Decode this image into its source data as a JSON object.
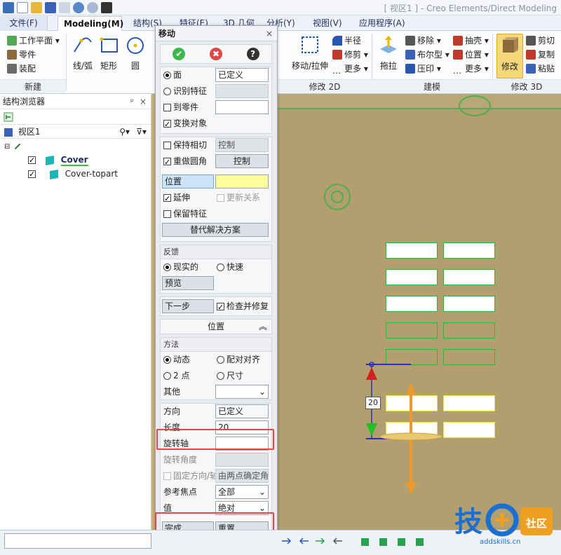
{
  "window": {
    "title": "[ 视区1 ] - Creo Elements/Direct Modeling"
  },
  "ribbon": {
    "tabs": [
      "文件(F)",
      "Modeling(M)",
      "结构(S)",
      "特征(E)",
      "3D 几何",
      "分析(Y)",
      "视图(V)",
      "应用程序(A)"
    ],
    "new_group": {
      "label": "新建",
      "items": [
        "工作平面",
        "零件",
        "装配"
      ]
    },
    "sketch_items": [
      "线/弧",
      "矩形",
      "圆"
    ],
    "modify2d_group": {
      "label": "修改 2D",
      "big": "移动/拉伸",
      "items": [
        "半径",
        "修剪",
        "更多"
      ]
    },
    "model_group": {
      "label": "建模",
      "big": "拖拉",
      "items_col1": [
        "移除",
        "布尔型",
        "压印"
      ],
      "items_col2": [
        "抽壳",
        "位置",
        "更多"
      ]
    },
    "modify3d_group": {
      "label": "修改 3D",
      "big": "修改",
      "items": [
        "剪切",
        "复制",
        "粘贴"
      ]
    }
  },
  "browser": {
    "title": "结构浏览器",
    "pin": "ᵖ",
    "close": "×",
    "root": "视区1",
    "nodes": [
      {
        "label": "Cover",
        "checked": true,
        "bold": true
      },
      {
        "label": "Cover-topart",
        "checked": true,
        "bold": false
      }
    ]
  },
  "dialog": {
    "title": "移动",
    "close": "×",
    "ok": "✔",
    "cancel": "✖",
    "help": "?",
    "face_label": "面",
    "face_value": "已定义",
    "identify_feature": "识别特征",
    "to_part": "到零件",
    "transform_objects": "变换对象",
    "keep_tangent": "保持相切",
    "keep_tangent_btn": "控制",
    "redo_fillet": "重做圆角",
    "redo_fillet_btn": "控制",
    "position": "位置",
    "extend": "延伸",
    "update_relation": "更新关系",
    "keep_feature": "保留特征",
    "alt_solution": "替代解决方案",
    "feedback_caption": "反馈",
    "realistic": "现实的",
    "fast": "快速",
    "preview": "预览",
    "next_step": "下一步",
    "check_repair": "检查并修复",
    "position_section": "位置",
    "method_caption": "方法",
    "dynamic": "动态",
    "align": "配对对齐",
    "two_points": "2 点",
    "dimension": "尺寸",
    "other": "其他",
    "direction_label": "方向",
    "direction_value": "已定义",
    "length_label": "长度",
    "length_value": "20",
    "rot_axis": "旋转轴",
    "rot_angle": "旋转角度",
    "fix_dir": "固定方向/轴",
    "fix_dir_value": "由两点确定角",
    "ref_focus_label": "参考焦点",
    "ref_focus_value": "全部",
    "value_label": "值",
    "value_value": "绝对",
    "done": "完成",
    "reset": "重置"
  },
  "viewport": {
    "dim_label": "20"
  },
  "logo": {
    "text1": "技",
    "text2": "社区",
    "url": "addskills.cn"
  }
}
